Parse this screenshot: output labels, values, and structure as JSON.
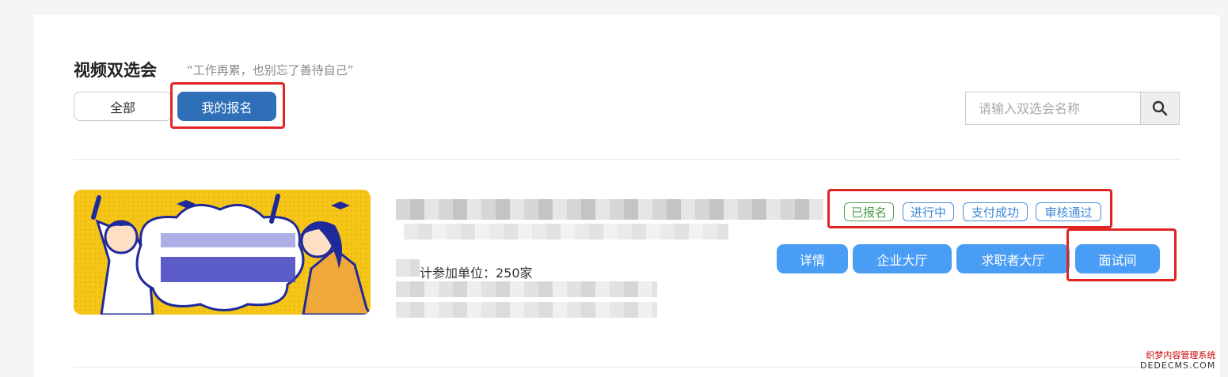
{
  "header": {
    "title": "视频双选会",
    "subtitle": "“工作再累，也别忘了善待自己”"
  },
  "tabs": [
    {
      "label": "全部"
    },
    {
      "label": "我的报名"
    }
  ],
  "search": {
    "placeholder": "请输入双选会名称",
    "icon": "search-icon"
  },
  "event": {
    "participants_text": "计参加单位：250家",
    "tags": [
      "已报名",
      "进行中",
      "支付成功",
      "审核通过"
    ],
    "actions": [
      "详情",
      "企业大厅",
      "求职者大厅",
      "面试间"
    ]
  },
  "watermark": {
    "line1": "织梦内容管理系统",
    "line2": "DEDECMS.COM"
  },
  "colors": {
    "accent": "#2f6fb8",
    "action_blue": "#4a9df5",
    "highlight_red": "#e02424",
    "tag_green": "#4c9a4c",
    "tag_blue": "#3f87d6",
    "banner_yellow": "#f5c518"
  }
}
